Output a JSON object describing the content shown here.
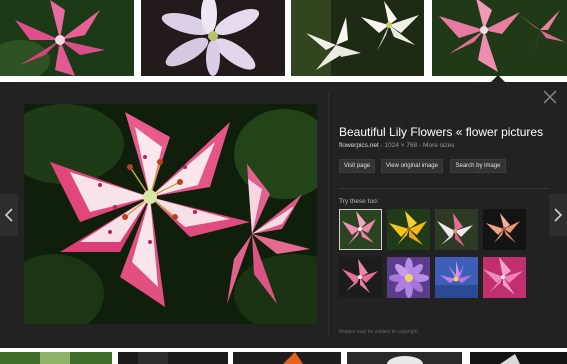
{
  "result_thumbnails": [
    {
      "icon": "pink-lily-thumbnail"
    },
    {
      "icon": "white-lily-thumbnail"
    },
    {
      "icon": "white-lilies-thumbnail"
    },
    {
      "icon": "pink-lily-selected-thumbnail"
    }
  ],
  "bottom_thumbnails": [
    {
      "icon": "green-leaf-thumbnail"
    },
    {
      "icon": "dark-flower-thumbnail"
    },
    {
      "icon": "orange-lily-thumbnail"
    },
    {
      "icon": "white-lily-thumbnail"
    },
    {
      "icon": "dark-lily-thumbnail"
    }
  ],
  "preview": {
    "title": "Beautiful Lily Flowers « flower pictures",
    "site": "flowerpics.net",
    "separator": " - ",
    "dimensions": "1024 × 768",
    "more_sizes": "More sizes",
    "buttons": {
      "visit_page": "Visit page",
      "view_original": "View original image",
      "search_by_image": "Search by image"
    },
    "try_these_label": "Try these too:",
    "copyright": "Images may be subject to copyright.",
    "suggestions": [
      {
        "icon": "pink-lily-suggestion"
      },
      {
        "icon": "yellow-lily-suggestion"
      },
      {
        "icon": "pink-white-lily-suggestion"
      },
      {
        "icon": "peach-lily-suggestion"
      },
      {
        "icon": "pink-stargazer-suggestion"
      },
      {
        "icon": "purple-flower-suggestion"
      },
      {
        "icon": "violet-water-lily-suggestion"
      },
      {
        "icon": "pink-flower-suggestion"
      }
    ]
  },
  "colors": {
    "panel_bg": "#222222",
    "title_text": "#ffffff",
    "button_bg": "#333333"
  }
}
